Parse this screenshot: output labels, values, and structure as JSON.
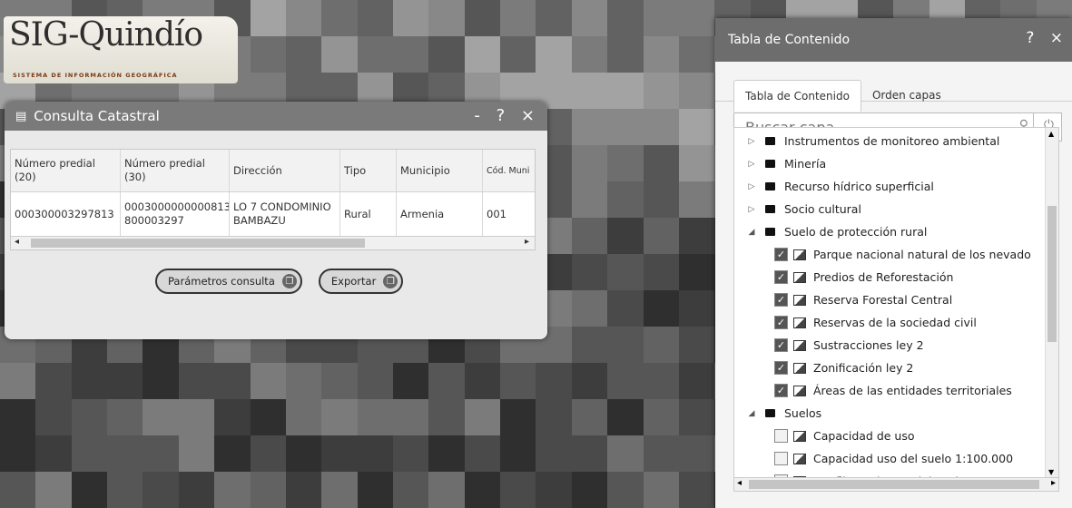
{
  "logo": {
    "title": "SIG-Quindío",
    "subtitle": "SISTEMA DE INFORMACIÓN GEOGRÁFICA"
  },
  "consulta": {
    "title": "Consulta Catastral",
    "controls": "- ? ×",
    "columns": [
      "Número predial (20)",
      "Número predial (30)",
      "Dirección",
      "Tipo",
      "Municipio",
      "Cód. Muni"
    ],
    "rows": [
      [
        "000300003297813",
        "0003000000000813 800003297",
        "LO 7 CONDOMINIO BAMBAZU",
        "Rural",
        "Armenia",
        "001"
      ]
    ],
    "buttons": {
      "params": "Parámetros consulta",
      "export": "Exportar"
    }
  },
  "toc": {
    "title": "Tabla de Contenido",
    "controls": "? ×",
    "tabs": [
      "Tabla de Contenido",
      "Orden capas"
    ],
    "search_placeholder": "Buscar capa",
    "items": [
      {
        "level": 0,
        "type": "folder",
        "expanded": false,
        "label": "Instrumentos de monitoreo ambiental"
      },
      {
        "level": 0,
        "type": "folder",
        "expanded": false,
        "label": "Minería"
      },
      {
        "level": 0,
        "type": "folder",
        "expanded": false,
        "label": "Recurso hídrico superficial"
      },
      {
        "level": 0,
        "type": "folder",
        "expanded": false,
        "label": "Socio cultural"
      },
      {
        "level": 0,
        "type": "folder",
        "expanded": true,
        "label": "Suelo de protección rural"
      },
      {
        "level": 1,
        "type": "layer",
        "checked": true,
        "label": "Parque nacional natural de los nevado"
      },
      {
        "level": 1,
        "type": "layer",
        "checked": true,
        "label": "Predios de Reforestación"
      },
      {
        "level": 1,
        "type": "layer",
        "checked": true,
        "label": "Reserva Forestal Central"
      },
      {
        "level": 1,
        "type": "layer",
        "checked": true,
        "label": "Reservas de la sociedad civil"
      },
      {
        "level": 1,
        "type": "layer",
        "checked": true,
        "label": "Sustracciones ley 2"
      },
      {
        "level": 1,
        "type": "layer",
        "checked": true,
        "label": "Zonificación ley 2"
      },
      {
        "level": 1,
        "type": "layer",
        "checked": true,
        "label": "Áreas de las entidades territoriales"
      },
      {
        "level": 0,
        "type": "folder",
        "expanded": true,
        "label": "Suelos"
      },
      {
        "level": 1,
        "type": "layer",
        "checked": false,
        "label": "Capacidad de uso"
      },
      {
        "level": 1,
        "type": "layer",
        "checked": false,
        "label": "Capacidad uso del suelo 1:100.000"
      },
      {
        "level": 1,
        "type": "layer",
        "checked": false,
        "label": "Conflictos de uso del suelo"
      }
    ]
  }
}
